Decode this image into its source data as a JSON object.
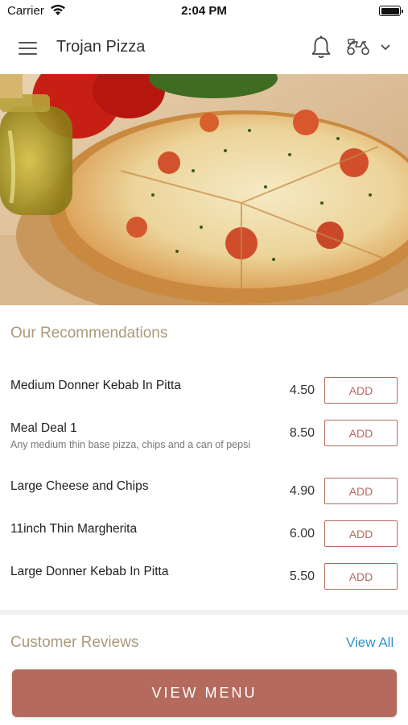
{
  "status_bar": {
    "carrier": "Carrier",
    "time": "2:04 PM"
  },
  "header": {
    "title": "Trojan Pizza",
    "icons": [
      "hamburger-menu-icon",
      "bell-icon",
      "delivery-scooter-icon",
      "chevron-down-icon"
    ]
  },
  "hero": {
    "image": "pizza-photo"
  },
  "recommendations": {
    "title": "Our Recommendations",
    "items": [
      {
        "name": "Medium Donner Kebab In Pitta",
        "description": "",
        "price": "4.50",
        "add_label": "ADD"
      },
      {
        "name": "Meal Deal 1",
        "description": "Any medium thin base pizza, chips and a can of pepsi",
        "price": "8.50",
        "add_label": "ADD"
      },
      {
        "name": "Large Cheese and Chips",
        "description": "",
        "price": "4.90",
        "add_label": "ADD"
      },
      {
        "name": "11inch Thin Margherita",
        "description": "",
        "price": "6.00",
        "add_label": "ADD"
      },
      {
        "name": "Large Donner Kebab In Pitta",
        "description": "",
        "price": "5.50",
        "add_label": "ADD"
      }
    ]
  },
  "reviews": {
    "title": "Customer Reviews",
    "view_all_label": "View All"
  },
  "footer": {
    "view_menu_label": "VIEW MENU"
  },
  "colors": {
    "accent": "#b46a5d",
    "section_title": "#a99a7a",
    "link": "#2f92c2"
  }
}
